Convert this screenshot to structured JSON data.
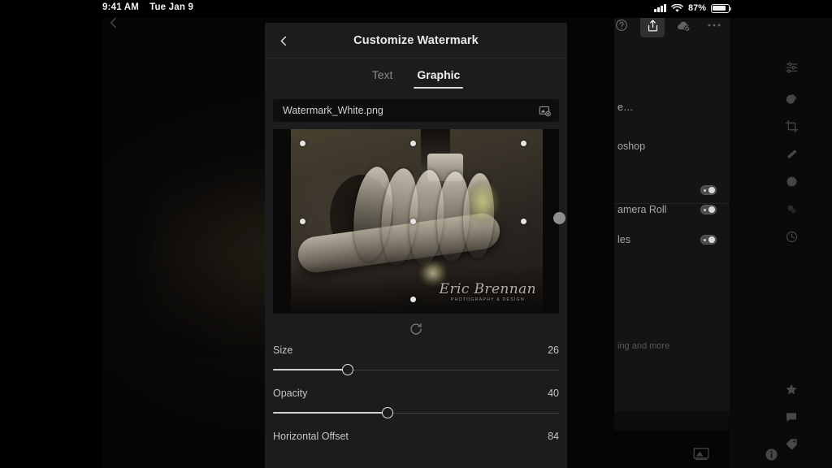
{
  "status_bar": {
    "time": "9:41 AM",
    "date": "Tue Jan 9",
    "battery_percent": "87%",
    "signal_icon": "cellular-signal-icon",
    "wifi_icon": "wifi-icon",
    "battery_icon": "battery-icon"
  },
  "toolbar": {
    "help_icon": "help-circle-icon",
    "share_icon": "share-export-icon",
    "cloud_icon": "cloud-check-icon",
    "more_icon": "more-options-icon"
  },
  "canvas": {
    "back_icon": "back-chevron-icon"
  },
  "background_panel": {
    "rows": [
      {
        "label": "e…",
        "toggle": false
      },
      {
        "label": "oshop",
        "toggle": false
      },
      {
        "label": "",
        "toggle": true
      },
      {
        "label": "amera Roll",
        "toggle": true
      },
      {
        "label": "les",
        "toggle": true
      }
    ],
    "description": "ing and more"
  },
  "tool_rail": {
    "icons": [
      "edit-sliders-icon",
      "color-profile-icon",
      "crop-icon",
      "healing-brush-icon",
      "masking-icon",
      "blur-icon",
      "history-icon",
      "star-rating-icon",
      "comment-icon",
      "tag-icon",
      "info-icon"
    ],
    "thumbnail_icon": "photo-thumbnail-icon"
  },
  "modal": {
    "back_icon": "back-chevron-icon",
    "title": "Customize Watermark",
    "tabs": [
      {
        "label": "Text",
        "active": false
      },
      {
        "label": "Graphic",
        "active": true
      }
    ],
    "file_field": {
      "value": "Watermark_White.png",
      "pick_icon": "add-image-icon"
    },
    "preview": {
      "watermark_name": "Eric Brennan",
      "watermark_subtitle": "PHOTOGRAPHY & DESIGN"
    },
    "reset_icon": "reset-refresh-icon",
    "sliders": [
      {
        "label": "Size",
        "value": "26",
        "percent": 26
      },
      {
        "label": "Opacity",
        "value": "40",
        "percent": 40
      },
      {
        "label": "Horizontal Offset",
        "value": "84",
        "percent": 84
      }
    ],
    "drag_handle": "modal-resize-handle"
  },
  "colors": {
    "modal_bg": "#1c1c1c",
    "accent_text": "#f0f0f0",
    "muted_text": "#8a8a8a",
    "slider_fill": "#d2d2d2"
  }
}
